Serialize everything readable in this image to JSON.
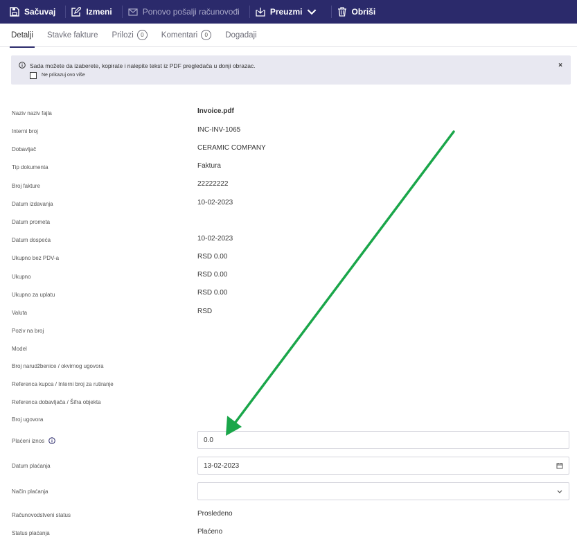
{
  "toolbar": {
    "save_label": "Sačuvaj",
    "edit_label": "Izmeni",
    "resend_label": "Ponovo pošalji računovođi",
    "download_label": "Preuzmi",
    "delete_label": "Obriši"
  },
  "tabs": [
    {
      "label": "Detalji",
      "active": true
    },
    {
      "label": "Stavke fakture"
    },
    {
      "label": "Prilozi",
      "count": "0"
    },
    {
      "label": "Komentari",
      "count": "0"
    },
    {
      "label": "Dogadaji"
    }
  ],
  "notice": {
    "text": "Sada možete da izaberete, kopirate i nalepite tekst iz PDF pregledača u donji obrazac.",
    "checkbox_label": "Ne prikazuj ovo više",
    "close": "×"
  },
  "fields": [
    {
      "label": "Naziv naziv fajla",
      "value": "Invoice.pdf"
    },
    {
      "label": "Interni broj",
      "value": "INC-INV-1065"
    },
    {
      "label": "Dobavljač",
      "value": "CERAMIC COMPANY"
    },
    {
      "label": "Tip dokumenta",
      "value": "Faktura"
    },
    {
      "label": "Broj fakture",
      "value": "22222222"
    },
    {
      "label": "Datum izdavanja",
      "value": "10-02-2023"
    },
    {
      "label": "Datum prometa",
      "value": ""
    },
    {
      "label": "Datum dospeća",
      "value": "10-02-2023"
    },
    {
      "label": "Ukupno bez PDV-a",
      "value": "RSD 0.00"
    },
    {
      "label": "Ukupno",
      "value": "RSD 0.00"
    },
    {
      "label": "Ukupno za uplatu",
      "value": "RSD 0.00"
    },
    {
      "label": "Valuta",
      "value": "RSD"
    },
    {
      "label": "Poziv na broj",
      "value": ""
    },
    {
      "label": "Model",
      "value": ""
    },
    {
      "label": "Broj narudžbenice / okvirnog ugovora",
      "value": ""
    },
    {
      "label": "Referenca kupca / Interni broj za rutiranje",
      "value": ""
    },
    {
      "label": "Referenca dobavljača / Šifra objekta",
      "value": ""
    },
    {
      "label": "Broj ugovora",
      "value": ""
    }
  ],
  "paid_amount": {
    "label": "Plaćeni iznos",
    "value": "0.0"
  },
  "payment_date": {
    "label": "Datum plaćanja",
    "value": "13-02-2023"
  },
  "payment_method": {
    "label": "Način plaćanja",
    "value": ""
  },
  "accounting_status": {
    "label": "Računovodstveni status",
    "value": "Prosledeno"
  },
  "payment_status": {
    "label": "Status plaćanja",
    "value": "Plaćeno"
  },
  "colors": {
    "toolbar_bg": "#2b2a6b",
    "notice_bg": "#e8e8f1",
    "arrow": "#1aa64a"
  }
}
